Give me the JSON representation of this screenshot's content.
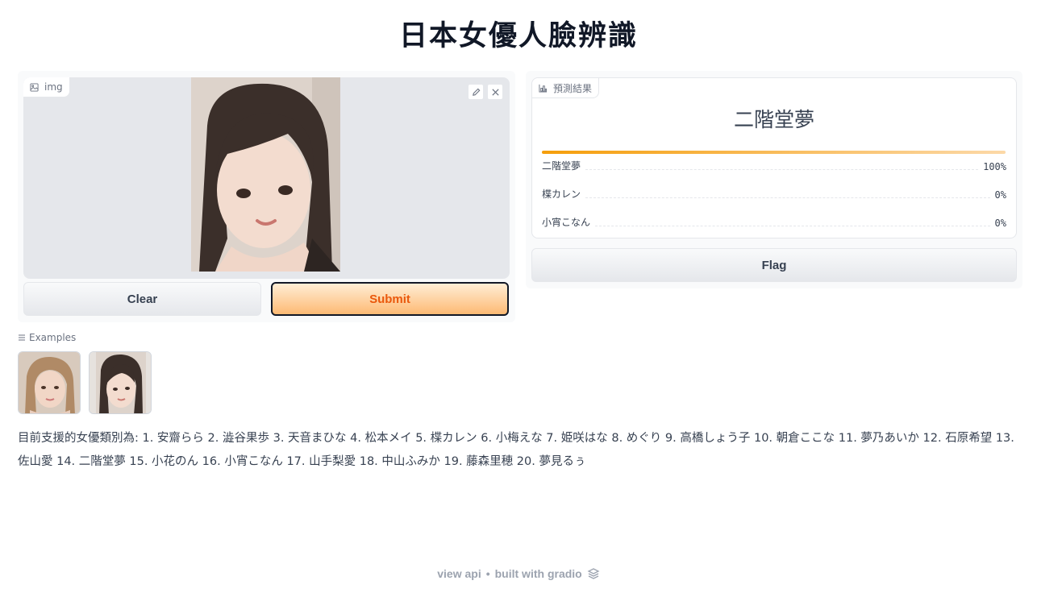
{
  "title": "日本女優人臉辨識",
  "input": {
    "label": "img",
    "icon": "image-icon",
    "tools": [
      "edit-icon",
      "close-icon"
    ]
  },
  "buttons": {
    "clear": "Clear",
    "submit": "Submit",
    "flag": "Flag"
  },
  "output": {
    "label": "預測結果",
    "icon": "bar-chart-icon",
    "top_label": "二階堂夢",
    "confidences": [
      {
        "label": "二階堂夢",
        "value": "100%",
        "fraction": 1.0
      },
      {
        "label": "楪カレン",
        "value": "0%",
        "fraction": 0.0
      },
      {
        "label": "小宵こなん",
        "value": "0%",
        "fraction": 0.0
      }
    ]
  },
  "examples": {
    "label": "Examples",
    "icon": "list-icon",
    "count": 2
  },
  "supported_text": "目前支援的女優類別為: 1. 安齋らら 2. 澁谷果歩 3. 天音まひな 4. 松本メイ 5. 楪カレン 6. 小梅えな 7. 姫咲はな 8. めぐり 9. 高橋しょう子 10. 朝倉ここな 11. 夢乃あいか 12. 石原希望 13. 佐山愛 14. 二階堂夢 15. 小花のん 16. 小宵こなん 17. 山手梨愛 18. 中山ふみか 19. 藤森里穂 20. 夢見るぅ",
  "footer": {
    "view_api": "view api",
    "separator": "•",
    "built_with": "built with gradio",
    "icon": "gradio-logo-icon"
  },
  "colors": {
    "accent": "#f59e0b",
    "submit_text": "#ea580c"
  }
}
